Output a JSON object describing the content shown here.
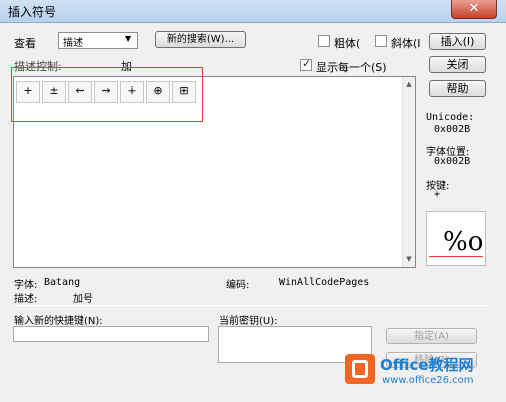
{
  "window": {
    "title": "插入符号",
    "close_glyph": "✕"
  },
  "view": {
    "label": "查看",
    "selected": "描述",
    "new_search_label": "新的搜索(W)...",
    "bold_label": "粗体(",
    "italic_label": "斜体(I",
    "insert_label": "插入(I)"
  },
  "description_control": {
    "label": "描述控制:",
    "value": "加"
  },
  "show_each": {
    "label": "显示每一个(S)",
    "checked": true
  },
  "buttons": {
    "close": "关闭",
    "help": "帮助"
  },
  "symbols": [
    "+",
    "±",
    "⇜",
    "⇝",
    "∔",
    "⊕",
    "⊞"
  ],
  "info": {
    "unicode_label": "Unicode:",
    "unicode_value": "0x002B",
    "position_label": "字体位置:",
    "position_value": "0x002B",
    "key_label": "按键:",
    "key_value": "+",
    "preview_text": "%o"
  },
  "font": {
    "label": "字体:",
    "value": "Batang",
    "encoding_label": "编码:",
    "encoding_value": "WinAllCodePages"
  },
  "desc": {
    "label": "描述:",
    "value": "加号"
  },
  "shortcut": {
    "new_label": "输入新的快捷键(N):",
    "current_label": "当前密钥(U):",
    "assign_label": "指定(A)",
    "remove_label": "移除(R)"
  },
  "watermark": {
    "brand": "Office教程网",
    "url": "www.office26.com"
  },
  "colors": {
    "accent": "#e23b3b",
    "brand_orange": "#f26522",
    "brand_blue": "#1d7fd1"
  }
}
